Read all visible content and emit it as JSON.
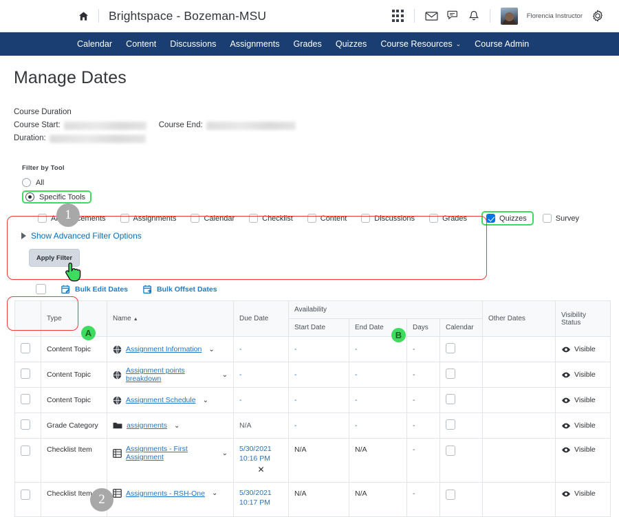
{
  "topbar": {
    "home_icon": "home-icon",
    "brand_title": "Brightspace - Bozeman-MSU",
    "waffle_icon": "apps-grid-icon",
    "mail_icon": "envelope-icon",
    "chat_icon": "message-bubble-icon",
    "bell_icon": "notification-bell-icon",
    "avatar": "user-avatar",
    "username": "Florencia Instructor",
    "settings_icon": "gear-icon"
  },
  "nav": {
    "items": [
      {
        "label": "Calendar",
        "has_caret": false
      },
      {
        "label": "Content",
        "has_caret": false
      },
      {
        "label": "Discussions",
        "has_caret": false
      },
      {
        "label": "Assignments",
        "has_caret": false
      },
      {
        "label": "Grades",
        "has_caret": false
      },
      {
        "label": "Quizzes",
        "has_caret": false
      },
      {
        "label": "Course Resources",
        "has_caret": true
      },
      {
        "label": "Course Admin",
        "has_caret": false
      }
    ],
    "caret": "⌄"
  },
  "page": {
    "title": "Manage Dates",
    "duration_heading": "Course Duration",
    "course_start_label": "Course Start:",
    "course_end_label": "Course End:",
    "duration_label": "Duration:"
  },
  "filter": {
    "title": "Filter by Tool",
    "radio_all": "All",
    "radio_specific": "Specific Tools",
    "selected_radio": "Specific Tools",
    "tools": [
      {
        "label": "Announcements",
        "checked": false
      },
      {
        "label": "Assignments",
        "checked": false
      },
      {
        "label": "Calendar",
        "checked": false
      },
      {
        "label": "Checklist",
        "checked": false
      },
      {
        "label": "Content",
        "checked": false
      },
      {
        "label": "Discussions",
        "checked": false
      },
      {
        "label": "Grades",
        "checked": false
      },
      {
        "label": "Quizzes",
        "checked": true
      },
      {
        "label": "Survey",
        "checked": false
      }
    ],
    "advanced_link": "Show Advanced Filter Options",
    "apply_button": "Apply Filter"
  },
  "callouts": {
    "one": "1",
    "two": "2",
    "a": "A",
    "b": "B",
    "highlight_color": "#3ddc5e",
    "outline_color": "#ee3b35",
    "badge_color": "#a8a8a8"
  },
  "bulk": {
    "edit_dates": "Bulk Edit Dates",
    "offset_dates": "Bulk Offset Dates",
    "edit_icon": "calendar-edit-icon",
    "offset_icon": "calendar-offset-icon"
  },
  "table": {
    "headers": {
      "type": "Type",
      "name": "Name",
      "name_sort": "▲",
      "due_date": "Due Date",
      "availability": "Availability",
      "start_date": "Start Date",
      "end_date": "End Date",
      "days": "Days",
      "calendar": "Calendar",
      "other_dates": "Other Dates",
      "visibility_status": "Visibility Status"
    },
    "rows": [
      {
        "type": "Content Topic",
        "name": "Assignment Information",
        "icon": "globe-icon",
        "due_date": "-",
        "due_date_style": "link",
        "start_date": "-",
        "end_date": "-",
        "days": "-",
        "other_dates": "",
        "visibility": "Visible",
        "extra": ""
      },
      {
        "type": "Content Topic",
        "name": "Assignment points breakdown",
        "icon": "globe-icon",
        "due_date": "-",
        "due_date_style": "link",
        "start_date": "-",
        "end_date": "-",
        "days": "-",
        "other_dates": "",
        "visibility": "Visible",
        "extra": ""
      },
      {
        "type": "Content Topic",
        "name": "Assignment Schedule",
        "icon": "globe-icon",
        "due_date": "-",
        "due_date_style": "link",
        "start_date": "-",
        "end_date": "-",
        "days": "-",
        "other_dates": "",
        "visibility": "Visible",
        "extra": ""
      },
      {
        "type": "Grade Category",
        "name": "assignments",
        "icon": "folder-icon",
        "due_date": "N/A",
        "due_date_style": "plain",
        "start_date": "-",
        "end_date": "-",
        "days": "-",
        "other_dates": "",
        "visibility": "Visible",
        "extra": ""
      },
      {
        "type": "Checklist Item",
        "name": "Assignments - First Assignment",
        "icon": "list-icon",
        "due_date": "5/30/2021 10:16 PM",
        "due_date_style": "date",
        "start_date": "N/A",
        "end_date": "N/A",
        "days": "-",
        "other_dates": "",
        "visibility": "Visible",
        "extra": "✕"
      },
      {
        "type": "Checklist Item",
        "name": "Assignments - RSH-One",
        "icon": "list-icon",
        "due_date": "5/30/2021 10:17 PM",
        "due_date_style": "date",
        "start_date": "N/A",
        "end_date": "N/A",
        "days": "-",
        "other_dates": "",
        "visibility": "Visible",
        "extra": ""
      }
    ]
  }
}
